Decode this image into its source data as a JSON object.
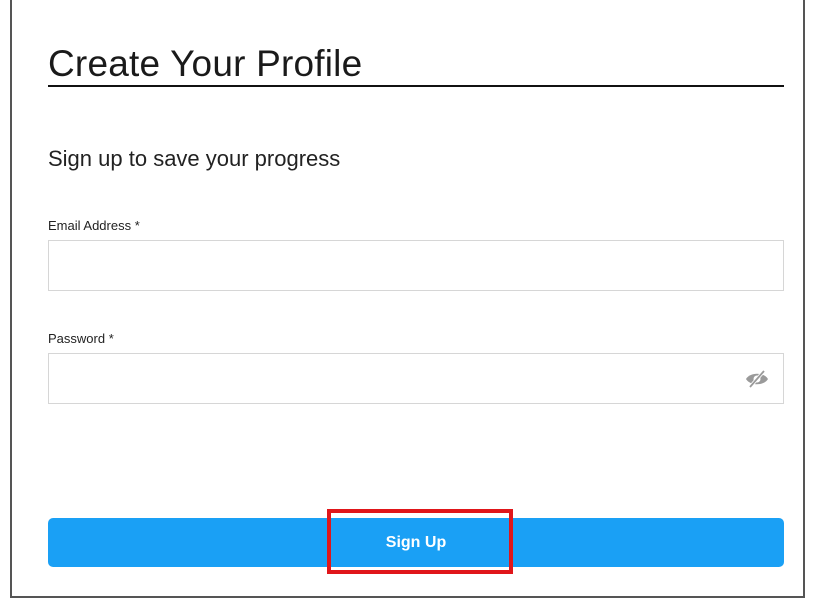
{
  "page": {
    "title": "Create Your Profile",
    "subtitle": "Sign up to save your progress"
  },
  "form": {
    "email": {
      "label": "Email Address",
      "required_mark": "*",
      "value": "",
      "placeholder": ""
    },
    "password": {
      "label": "Password",
      "required_mark": "*",
      "value": "",
      "placeholder": "",
      "toggle_icon": "eye-slash-icon"
    },
    "submit_label": "Sign Up"
  },
  "colors": {
    "accent": "#1aa0f5",
    "highlight": "#e0161a"
  }
}
